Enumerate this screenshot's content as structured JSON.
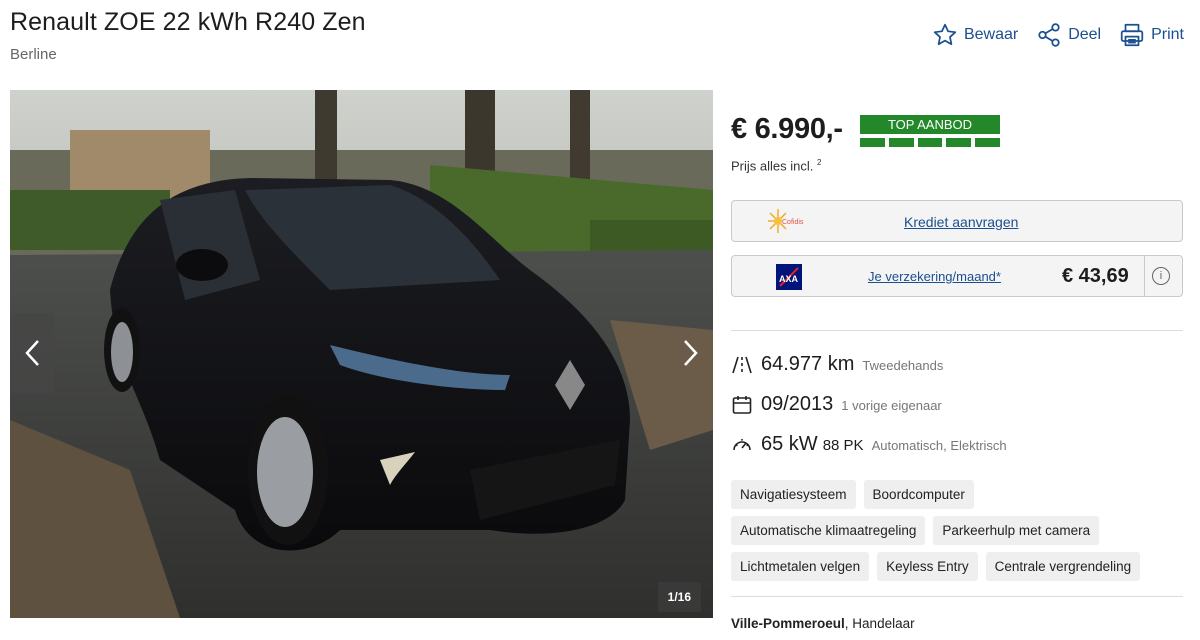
{
  "header": {
    "title": "Renault ZOE 22 kWh R240 Zen",
    "subtitle": "Berline",
    "actions": [
      {
        "label": "Bewaar",
        "icon": "star-icon"
      },
      {
        "label": "Deel",
        "icon": "share-icon"
      },
      {
        "label": "Print",
        "icon": "printer-icon"
      }
    ]
  },
  "gallery": {
    "counter": "1/16",
    "prev_icon": "chevron-left-icon",
    "next_icon": "chevron-right-icon"
  },
  "pricing": {
    "price": "€ 6.990,-",
    "badge": "TOP AANBOD",
    "badge_level": 5,
    "incl_note": "Prijs alles incl.",
    "incl_sup": "2"
  },
  "credit": {
    "logo": "Cofidis",
    "link": "Krediet aanvragen"
  },
  "insurance": {
    "logo": "AXA",
    "link": "Je verzekering/maand*",
    "price": "€ 43,69",
    "info_icon": "i"
  },
  "specs": {
    "mileage": {
      "value": "64.977 km",
      "sub": "Tweedehands",
      "icon": "road-icon"
    },
    "date": {
      "value": "09/2013",
      "sub": "1 vorige eigenaar",
      "icon": "calendar-icon"
    },
    "power": {
      "value": "65 kW",
      "unit": "88 PK",
      "sub": "Automatisch, Elektrisch",
      "icon": "speedometer-icon"
    }
  },
  "features": [
    [
      "Navigatiesysteem",
      "Boordcomputer"
    ],
    [
      "Automatische klimaatregeling",
      "Parkeerhulp met camera"
    ],
    [
      "Lichtmetalen velgen",
      "Keyless Entry",
      "Centrale vergrendeling"
    ]
  ],
  "seller": {
    "city": "Ville-Pommeroeul",
    "type": ", Handelaar"
  },
  "colors": {
    "accent": "#1b4f8f",
    "badge_green": "#23882a"
  }
}
